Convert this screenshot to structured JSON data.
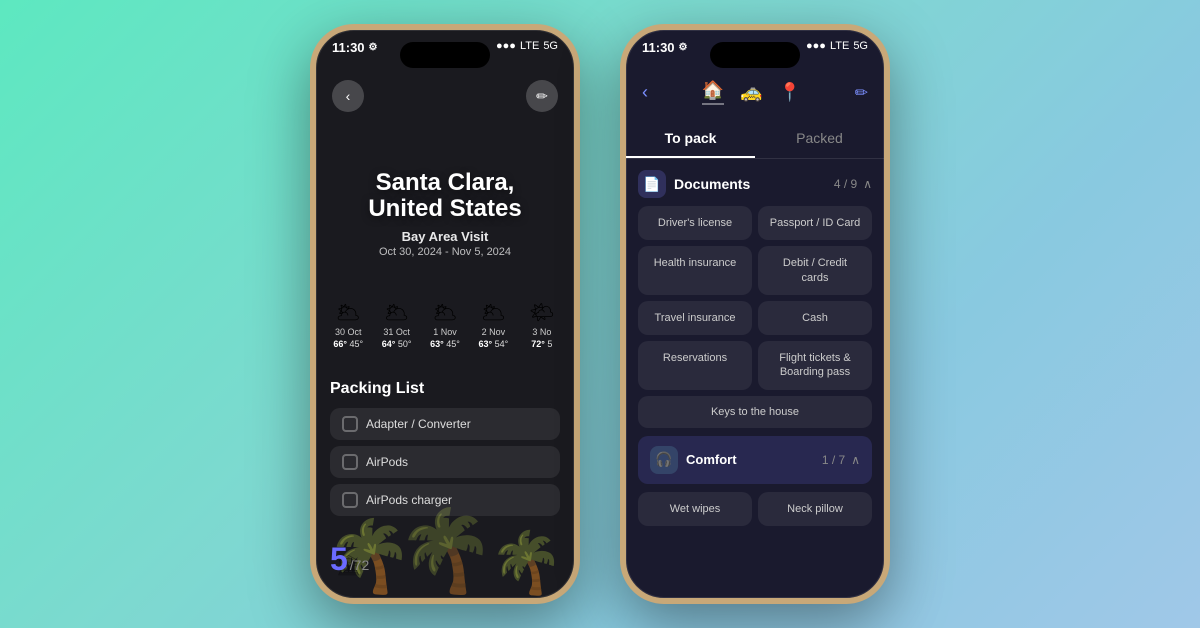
{
  "background": "#7dd9d0",
  "phone1": {
    "status": {
      "time": "11:30",
      "gear": "⚙",
      "signal": "●●●",
      "lte": "LTE",
      "network": "5G"
    },
    "header": {
      "back_label": "‹",
      "edit_label": "✏"
    },
    "city": "Santa Clara,\nUnited States",
    "trip_name": "Bay Area Visit",
    "dates": "Oct 30, 2024 - Nov 5, 2024",
    "weather": [
      {
        "date": "30 Oct",
        "high": "66°",
        "low": "45°",
        "icon": "🌥"
      },
      {
        "date": "31 Oct",
        "high": "64°",
        "low": "50°",
        "icon": "🌥"
      },
      {
        "date": "1 Nov",
        "high": "63°",
        "low": "45°",
        "icon": "🌥"
      },
      {
        "date": "2 Nov",
        "high": "63°",
        "low": "54°",
        "icon": "🌥"
      },
      {
        "date": "3 No",
        "high": "72°",
        "low": "5",
        "icon": "🌤"
      }
    ],
    "packing": {
      "title": "Packing List",
      "count": "5",
      "total": "/72",
      "items": [
        {
          "label": "Adapter / Converter",
          "checked": false
        },
        {
          "label": "AirPods",
          "checked": false
        },
        {
          "label": "AirPods charger",
          "checked": false
        }
      ]
    }
  },
  "phone2": {
    "status": {
      "time": "11:30",
      "gear": "⚙",
      "signal": "●●●",
      "lte": "LTE",
      "network": "5G"
    },
    "nav": {
      "back_label": "‹",
      "icons": [
        "🏠",
        "🚕",
        "📍"
      ],
      "active_index": 0,
      "edit_label": "✏"
    },
    "tabs": [
      {
        "label": "To pack",
        "active": true
      },
      {
        "label": "Packed",
        "active": false
      }
    ],
    "documents": {
      "category": "Documents",
      "icon": "📄",
      "count": "4 / 9",
      "items_left": [
        "Driver's license",
        "Health insurance",
        "Travel insurance",
        "Reservations",
        "Keys to the house"
      ],
      "items_right": [
        "Passport / ID Card",
        "Debit / Credit cards",
        "Cash",
        "Flight tickets &\nBoarding pass"
      ]
    },
    "comfort": {
      "category": "Comfort",
      "icon": "🎧",
      "count": "1 / 7",
      "items_left": [
        "Wet wipes"
      ],
      "items_right": [
        "Neck pillow"
      ]
    }
  }
}
